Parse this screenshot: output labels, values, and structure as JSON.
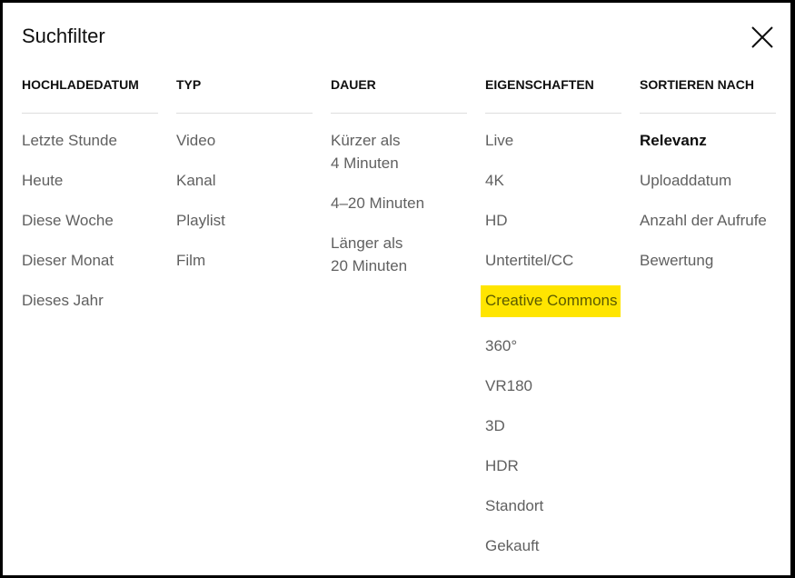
{
  "dialog": {
    "title": "Suchfilter",
    "close_icon": "close-icon"
  },
  "highlight_color": "#ffe500",
  "columns": [
    {
      "header": "HOCHLADEDATUM",
      "items": [
        "Letzte Stunde",
        "Heute",
        "Diese Woche",
        "Dieser Monat",
        "Dieses Jahr"
      ]
    },
    {
      "header": "TYP",
      "items": [
        "Video",
        "Kanal",
        "Playlist",
        "Film"
      ]
    },
    {
      "header": "DAUER",
      "items": [
        [
          "Kürzer als",
          "4 Minuten"
        ],
        "4–20 Minuten",
        [
          "Länger als",
          "20 Minuten"
        ]
      ]
    },
    {
      "header": "EIGENSCHAFTEN",
      "items": [
        "Live",
        "4K",
        "HD",
        "Untertitel/CC",
        "Creative Commons",
        "360°",
        "VR180",
        "3D",
        "HDR",
        "Standort",
        "Gekauft"
      ],
      "highlighted": "Creative Commons"
    },
    {
      "header": "SORTIEREN NACH",
      "items": [
        "Relevanz",
        "Uploaddatum",
        "Anzahl der Aufrufe",
        "Bewertung"
      ],
      "selected": "Relevanz"
    }
  ]
}
